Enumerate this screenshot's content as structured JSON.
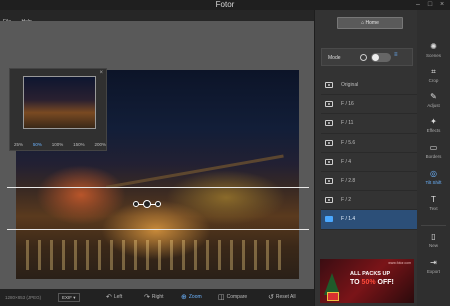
{
  "window": {
    "title": "Fotor",
    "minimize_glyph": "–",
    "maximize_glyph": "□",
    "close_glyph": "×"
  },
  "menu": {
    "items": [
      "File",
      "Help"
    ]
  },
  "navigator": {
    "close_glyph": "×",
    "zoom_levels": [
      "25%",
      "50%",
      "100%",
      "150%",
      "200%"
    ],
    "active_zoom": "50%"
  },
  "bottombar": {
    "resolution": "1280×853 (JPEG)",
    "exif": "EXIF ▾",
    "buttons": [
      {
        "label": "Left",
        "icon": "rotate-left-icon",
        "glyph": "↶"
      },
      {
        "label": "Right",
        "icon": "rotate-right-icon",
        "glyph": "↷"
      },
      {
        "label": "Zoom",
        "icon": "zoom-icon",
        "glyph": "⊕"
      },
      {
        "label": "Compare",
        "icon": "compare-icon",
        "glyph": "◫"
      },
      {
        "label": "Reset All",
        "icon": "reset-icon",
        "glyph": "↺"
      }
    ]
  },
  "panel": {
    "home_label": "⌂ Home",
    "mode_label": "Mode",
    "aperture_items": [
      "Original",
      "F / 16",
      "F / 11",
      "F / 5.6",
      "F / 4",
      "F / 2.8",
      "F / 2",
      "F / 1.4"
    ],
    "selected_aperture": "F / 1.4",
    "ad": {
      "line1": "ALL PACKS UP",
      "line2_prefix": "TO ",
      "line2_pct": "50%",
      "line2_suffix": " OFF!",
      "url": "www.fotor.com"
    }
  },
  "tools": [
    {
      "label": "Scenes",
      "icon": "scenes-icon",
      "glyph": "✺"
    },
    {
      "label": "Crop",
      "icon": "crop-icon",
      "glyph": "⌗"
    },
    {
      "label": "Adjust",
      "icon": "adjust-icon",
      "glyph": "✎"
    },
    {
      "label": "Effects",
      "icon": "effects-icon",
      "glyph": "✦"
    },
    {
      "label": "Borders",
      "icon": "borders-icon",
      "glyph": "▭"
    },
    {
      "label": "Tilt Shift",
      "icon": "tilt-shift-icon",
      "glyph": "◎"
    },
    {
      "label": "Text",
      "icon": "text-icon",
      "glyph": "T"
    },
    {
      "label": "New",
      "icon": "new-file-icon",
      "glyph": "▯"
    },
    {
      "label": "Export",
      "icon": "export-icon",
      "glyph": "⇥"
    }
  ],
  "active_tool": "Tilt Shift",
  "colors": {
    "accent": "#6cb4ff",
    "selected_row": "#2c4f78"
  }
}
